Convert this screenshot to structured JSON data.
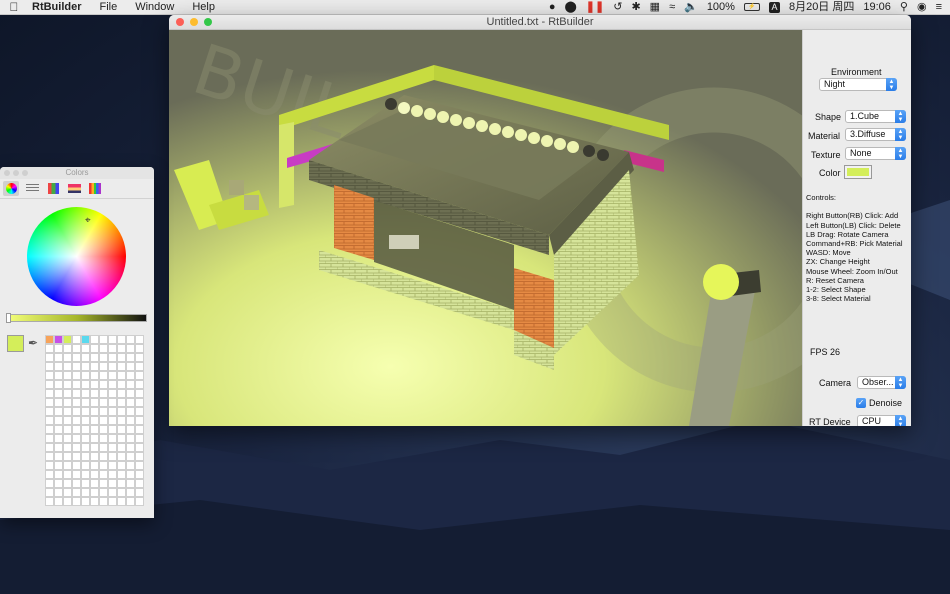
{
  "menubar": {
    "app": "RtBuilder",
    "menus": [
      "File",
      "Window",
      "Help"
    ],
    "battery": "100%",
    "date": "8月20日 周四",
    "time": "19:06",
    "input_mode": "A"
  },
  "window": {
    "title": "Untitled.txt - RtBuilder"
  },
  "sidebar": {
    "environment_label": "Environment",
    "environment_value": "Night",
    "shape_label": "Shape",
    "shape_value": "1.Cube",
    "material_label": "Material",
    "material_value": "3.Diffuse",
    "texture_label": "Texture",
    "texture_value": "None",
    "color_label": "Color",
    "color_value": "#d4ee5a",
    "controls_title": "Controls:",
    "controls": [
      "Right Button(RB) Click: Add",
      "Left Button(LB) Click: Delete",
      "LB Drag: Rotate Camera",
      "Command+RB: Pick Material",
      "WASD: Move",
      "ZX: Change Height",
      "Mouse Wheel: Zoom In/Out",
      "R: Reset Camera",
      "1-2: Select Shape",
      "3-8: Select Material"
    ],
    "fps": "FPS 26",
    "camera_label": "Camera",
    "camera_value": "Obser...",
    "denoise_label": "Denoise",
    "denoise_checked": true,
    "device_label": "RT Device",
    "device_value": "CPU"
  },
  "colors_panel": {
    "title": "Colors",
    "current_color": "#d4ee5a",
    "swatches": [
      "#f7a35a",
      "#c650e8",
      "#d4ee5a",
      "#ffffff",
      "#5ad9ee"
    ]
  },
  "icons": {
    "apple": "apple-icon",
    "qq": "qq-icon",
    "bluetooth": "bluetooth-icon",
    "wifi": "wifi-icon",
    "volume": "volume-icon",
    "search": "search-icon",
    "siri": "siri-icon",
    "list": "notification-list-icon"
  }
}
